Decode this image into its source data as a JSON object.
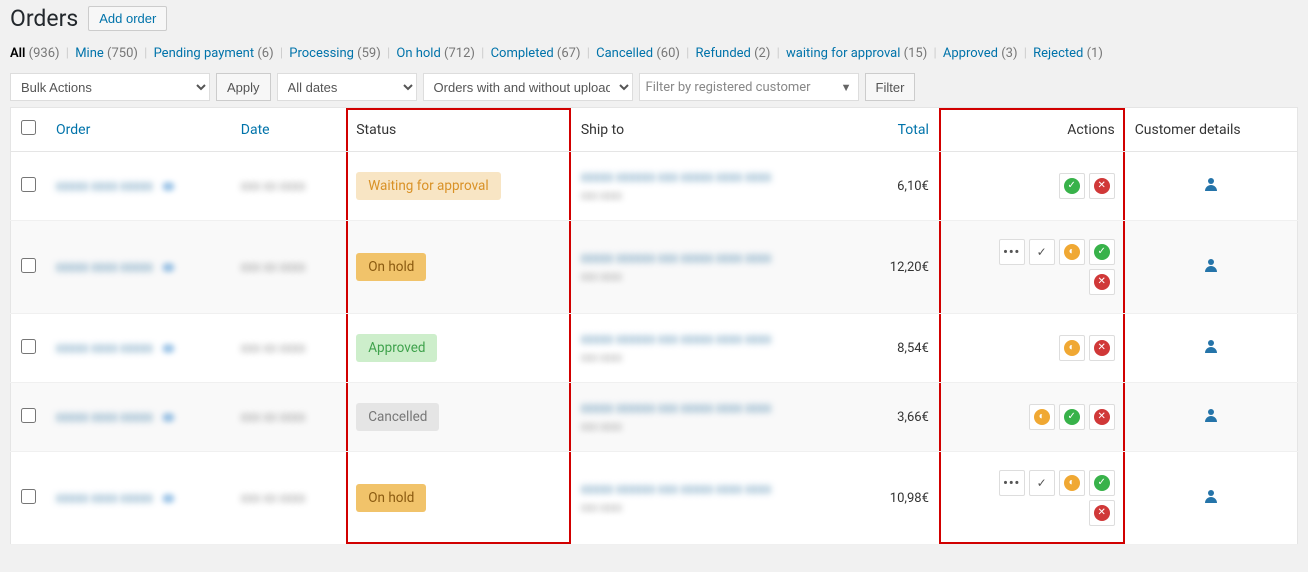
{
  "page": {
    "title": "Orders",
    "add_button": "Add order"
  },
  "status_filters": [
    {
      "label": "All",
      "count": 936,
      "active": true
    },
    {
      "label": "Mine",
      "count": 750
    },
    {
      "label": "Pending payment",
      "count": 6
    },
    {
      "label": "Processing",
      "count": 59
    },
    {
      "label": "On hold",
      "count": 712
    },
    {
      "label": "Completed",
      "count": 67
    },
    {
      "label": "Cancelled",
      "count": 60
    },
    {
      "label": "Refunded",
      "count": 2
    },
    {
      "label": "waiting for approval",
      "count": 15
    },
    {
      "label": "Approved",
      "count": 3
    },
    {
      "label": "Rejected",
      "count": 1
    }
  ],
  "toolbar": {
    "bulk_actions": "Bulk Actions",
    "apply": "Apply",
    "date_filter": "All dates",
    "upload_filter": "Orders with and without uploads",
    "customer_filter_placeholder": "Filter by registered customer",
    "filter_button": "Filter"
  },
  "columns": {
    "order": "Order",
    "date": "Date",
    "status": "Status",
    "ship_to": "Ship to",
    "total": "Total",
    "actions": "Actions",
    "customer_details": "Customer details"
  },
  "rows": [
    {
      "status_key": "waiting-approval",
      "status_label": "Waiting for approval",
      "total": "6,10€",
      "actions": [
        [
          "check-green",
          "cross-red"
        ]
      ]
    },
    {
      "status_key": "on-hold",
      "status_label": "On hold",
      "total": "12,20€",
      "actions": [
        [
          "dots",
          "check-thin",
          "clock-orange",
          "check-green"
        ],
        [
          "cross-red"
        ]
      ]
    },
    {
      "status_key": "approved",
      "status_label": "Approved",
      "total": "8,54€",
      "actions": [
        [
          "clock-orange",
          "cross-red"
        ]
      ]
    },
    {
      "status_key": "cancelled",
      "status_label": "Cancelled",
      "total": "3,66€",
      "actions": [
        [
          "clock-orange",
          "check-green",
          "cross-red"
        ]
      ]
    },
    {
      "status_key": "on-hold",
      "status_label": "On hold",
      "total": "10,98€",
      "actions": [
        [
          "dots",
          "check-thin",
          "clock-orange",
          "check-green"
        ],
        [
          "cross-red"
        ]
      ]
    }
  ]
}
